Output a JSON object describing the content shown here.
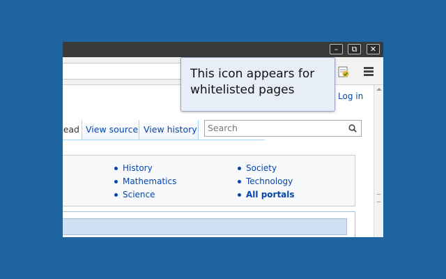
{
  "window_controls": {
    "minimize": "–",
    "restore": "⧉",
    "close": "✕"
  },
  "callout": {
    "text": "This icon appears for\nwhitelisted pages"
  },
  "page": {
    "login": "Log in",
    "tabs": [
      {
        "label": "ead"
      },
      {
        "label": "View source"
      },
      {
        "label": "View history"
      }
    ],
    "search_placeholder": "Search",
    "portals": {
      "col1": [
        "History",
        "Mathematics",
        "Science"
      ],
      "col2": [
        "Society",
        "Technology",
        "All portals"
      ]
    }
  },
  "icons": {
    "extension": "whitelist-check-icon",
    "menu": "hamburger-menu-icon",
    "search": "magnifier-icon"
  },
  "colors": {
    "desktop": "#1d64a0",
    "link": "#0645ad",
    "callout_bg": "#e8eef8"
  }
}
